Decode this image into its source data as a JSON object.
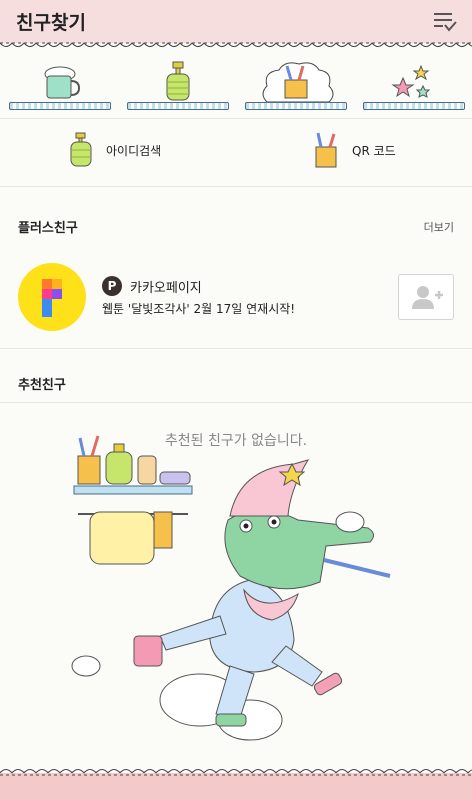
{
  "header": {
    "title": "친구찾기",
    "menu_icon": "list-check-icon"
  },
  "tabs": [
    {
      "icon": "cup-icon",
      "selected": false
    },
    {
      "icon": "lotion-bottle-icon",
      "selected": false
    },
    {
      "icon": "toothbrush-cup-icon",
      "selected": true
    },
    {
      "icon": "stars-icon",
      "selected": false
    }
  ],
  "actions": {
    "id_search": {
      "label": "아이디검색",
      "icon": "lotion-bottle-icon"
    },
    "qr_code": {
      "label": "QR 코드",
      "icon": "toothbrush-cup-icon"
    }
  },
  "plus_friends": {
    "title": "플러스친구",
    "more_label": "더보기",
    "item": {
      "name": "카카오페이지",
      "badge_letter": "P",
      "status": "웹툰 '달빛조각사' 2월 17일 연재시작!",
      "avatar_icon": "kakaopage-logo"
    }
  },
  "recommended": {
    "title": "추천친구",
    "empty_text": "추천된 친구가 없습니다."
  },
  "colors": {
    "header_bg": "#f7dede",
    "lace_pink": "#f4c9c9",
    "accent_yellow": "#ffe11a"
  }
}
